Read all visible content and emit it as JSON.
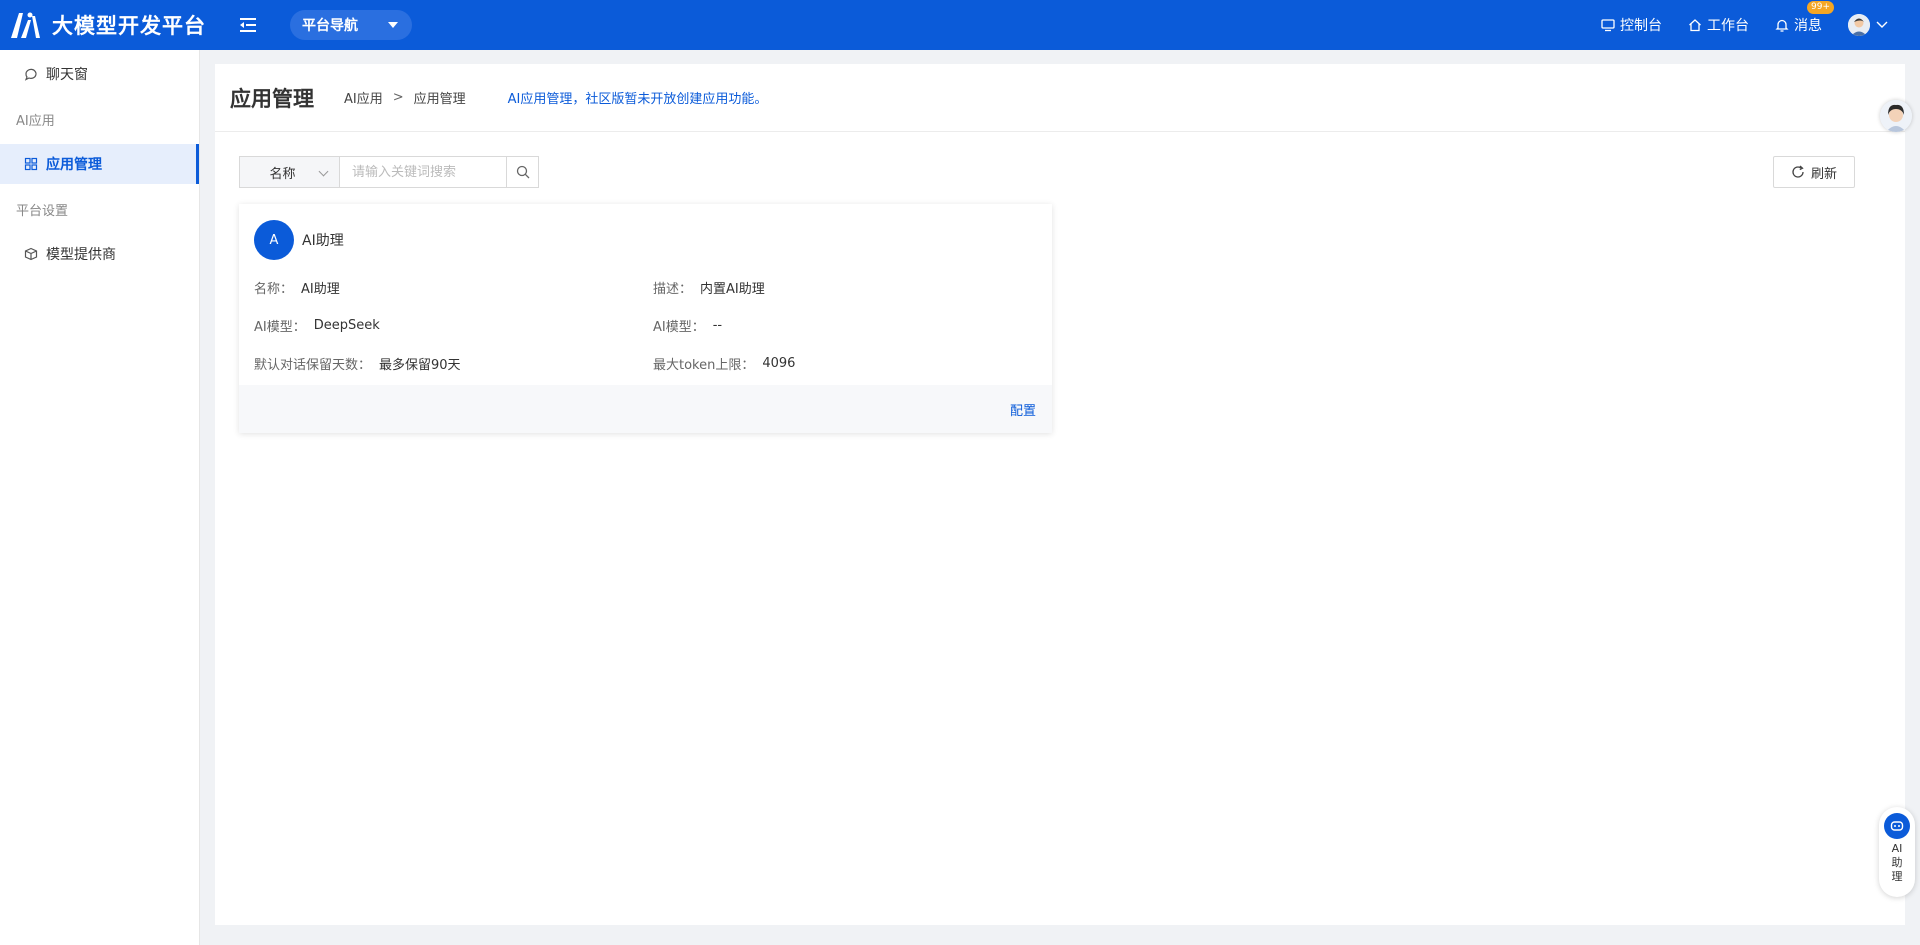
{
  "colors": {
    "brand": "#0b5bd9",
    "badge": "#f5a623"
  },
  "header": {
    "app_title": "大模型开发平台",
    "nav_label": "平台导航",
    "links": {
      "console": "控制台",
      "workbench": "工作台",
      "messages": "消息",
      "messages_badge": "99+"
    },
    "icons": [
      "logo-icon",
      "menu-fold-icon",
      "monitor-icon",
      "home-icon",
      "bell-icon",
      "user-avatar-icon",
      "chevron-down-icon"
    ]
  },
  "sidebar": {
    "chat": "聊天窗",
    "group_ai": "AI应用",
    "app_manage": "应用管理",
    "group_platform": "平台设置",
    "model_provider": "模型提供商"
  },
  "page": {
    "title": "应用管理",
    "breadcrumb": [
      "AI应用",
      ">",
      "应用管理"
    ],
    "notice": "AI应用管理，社区版暂未开放创建应用功能。"
  },
  "toolbar": {
    "filter_field": "名称",
    "search_placeholder": "请输入关键词搜索",
    "refresh_label": "刷新"
  },
  "app_card": {
    "avatar_letter": "A",
    "name": "AI助理",
    "fields": [
      {
        "key": "名称：",
        "value": "AI助理"
      },
      {
        "key": "描述：",
        "value": "内置AI助理"
      },
      {
        "key": "AI模型：",
        "value": "DeepSeek"
      },
      {
        "key": "AI模型：",
        "value": "--"
      },
      {
        "key": "默认对话保留天数：",
        "value": "最多保留90天"
      },
      {
        "key": "最大token上限：",
        "value": "4096"
      }
    ],
    "action": "配置"
  },
  "floating": {
    "assistant_label": "AI助理"
  }
}
